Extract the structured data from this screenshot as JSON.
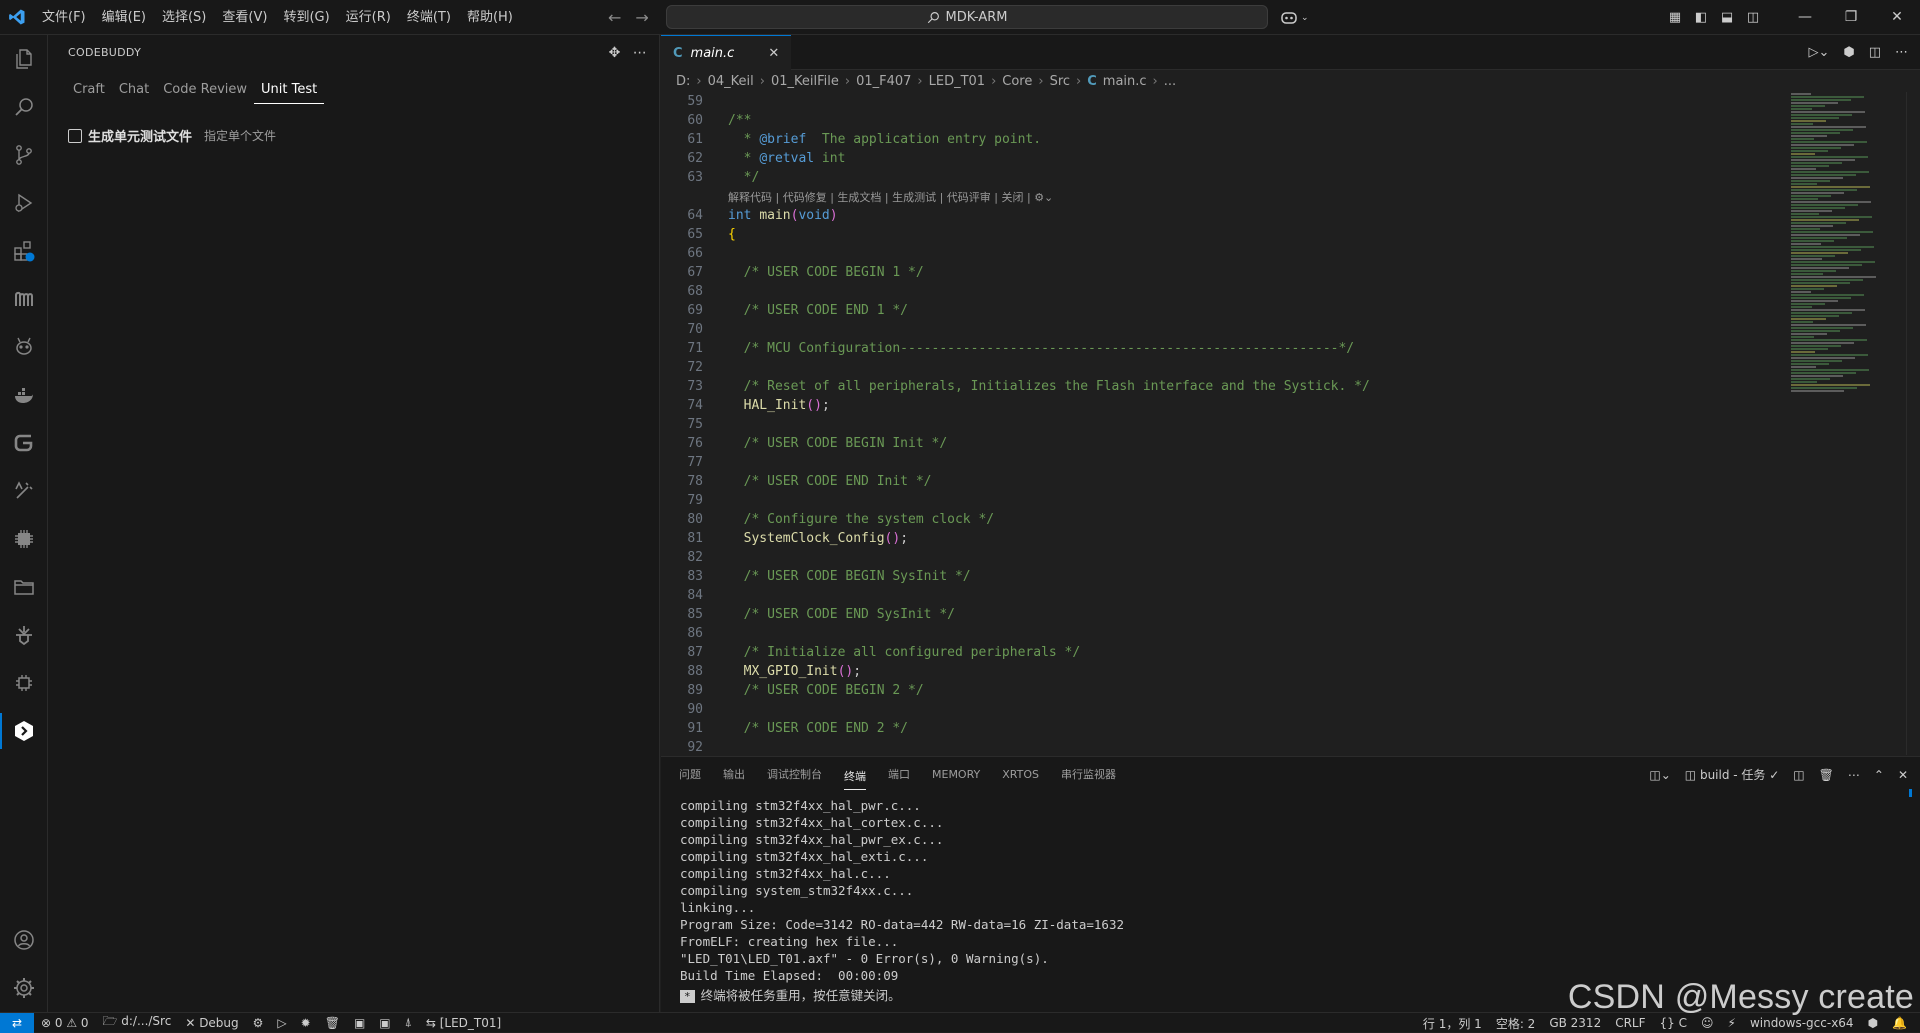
{
  "titlebar": {
    "menu": [
      "文件(F)",
      "编辑(E)",
      "选择(S)",
      "查看(V)",
      "转到(G)",
      "运行(R)",
      "终端(T)",
      "帮助(H)"
    ],
    "search": "MDK-ARM"
  },
  "sidebar": {
    "title": "CODEBUDDY",
    "tabs": [
      "Craft",
      "Chat",
      "Code Review",
      "Unit Test"
    ],
    "active_tab": "Unit Test",
    "action_label": "生成单元测试文件",
    "action_hint": "指定单个文件"
  },
  "editor": {
    "tab_name": "main.c",
    "breadcrumb": [
      "D:",
      "04_Keil",
      "01_KeilFile",
      "01_F407",
      "LED_T01",
      "Core",
      "Src",
      "main.c",
      "..."
    ],
    "codelens": "解释代码 | 代码修复 | 生成文档 | 生成测试 | 代码评审 | 关闭 |",
    "lines": [
      {
        "n": "59",
        "t": ""
      },
      {
        "n": "60",
        "t": "/**"
      },
      {
        "n": "61",
        "t": "  * @brief  The application entry point."
      },
      {
        "n": "62",
        "t": "  * @retval int"
      },
      {
        "n": "63",
        "t": "  */"
      },
      {
        "n": "64",
        "t": "int main(void)"
      },
      {
        "n": "65",
        "t": "{"
      },
      {
        "n": "66",
        "t": ""
      },
      {
        "n": "67",
        "t": "  /* USER CODE BEGIN 1 */"
      },
      {
        "n": "68",
        "t": ""
      },
      {
        "n": "69",
        "t": "  /* USER CODE END 1 */"
      },
      {
        "n": "70",
        "t": ""
      },
      {
        "n": "71",
        "t": "  /* MCU Configuration--------------------------------------------------------*/"
      },
      {
        "n": "72",
        "t": ""
      },
      {
        "n": "73",
        "t": "  /* Reset of all peripherals, Initializes the Flash interface and the Systick. */"
      },
      {
        "n": "74",
        "t": "  HAL_Init();"
      },
      {
        "n": "75",
        "t": ""
      },
      {
        "n": "76",
        "t": "  /* USER CODE BEGIN Init */"
      },
      {
        "n": "77",
        "t": ""
      },
      {
        "n": "78",
        "t": "  /* USER CODE END Init */"
      },
      {
        "n": "79",
        "t": ""
      },
      {
        "n": "80",
        "t": "  /* Configure the system clock */"
      },
      {
        "n": "81",
        "t": "  SystemClock_Config();"
      },
      {
        "n": "82",
        "t": ""
      },
      {
        "n": "83",
        "t": "  /* USER CODE BEGIN SysInit */"
      },
      {
        "n": "84",
        "t": ""
      },
      {
        "n": "85",
        "t": "  /* USER CODE END SysInit */"
      },
      {
        "n": "86",
        "t": ""
      },
      {
        "n": "87",
        "t": "  /* Initialize all configured peripherals */"
      },
      {
        "n": "88",
        "t": "  MX_GPIO_Init();"
      },
      {
        "n": "89",
        "t": "  /* USER CODE BEGIN 2 */"
      },
      {
        "n": "90",
        "t": ""
      },
      {
        "n": "91",
        "t": "  /* USER CODE END 2 */"
      },
      {
        "n": "92",
        "t": ""
      }
    ]
  },
  "panel": {
    "tabs": [
      "问题",
      "输出",
      "调试控制台",
      "终端",
      "端口",
      "MEMORY",
      "XRTOS",
      "串行监视器"
    ],
    "active_tab": "终端",
    "task_label": "build - 任务",
    "terminal_lines": [
      "compiling stm32f4xx_hal_pwr.c...",
      "compiling stm32f4xx_hal_cortex.c...",
      "compiling stm32f4xx_hal_pwr_ex.c...",
      "compiling stm32f4xx_hal_exti.c...",
      "compiling stm32f4xx_hal.c...",
      "compiling system_stm32f4xx.c...",
      "linking...",
      "Program Size: Code=3142 RO-data=442 RW-data=16 ZI-data=1632",
      "FromELF: creating hex file...",
      "\"LED_T01\\LED_T01.axf\" - 0 Error(s), 0 Warning(s).",
      "Build Time Elapsed:  00:00:09"
    ],
    "notice_mark": "*",
    "notice": "终端将被任务重用，按任意键关闭。"
  },
  "statusbar": {
    "problems": "⊗ 0 ⚠ 0",
    "path": "d:/.../Src",
    "debug": "Debug",
    "target": "[LED_T01]",
    "position": "行 1，列 1",
    "spaces": "空格: 2",
    "encoding": "GB 2312",
    "eol": "CRLF",
    "language": "{} C",
    "toolchain": "windows-gcc-x64"
  },
  "watermark": "CSDN @Messy create",
  "colors": {
    "accent": "#0078d4",
    "bg": "#1f1f1f",
    "comment": "#6a9955",
    "keyword": "#569cd6",
    "function": "#dcdcaa"
  }
}
